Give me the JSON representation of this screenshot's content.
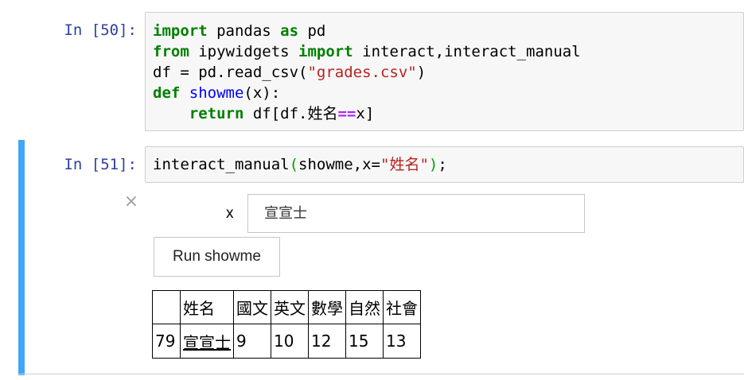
{
  "cell50": {
    "prompt": "In [50]:",
    "lines": [
      {
        "parts": [
          [
            "kw",
            "import"
          ],
          [
            "txt",
            " pandas "
          ],
          [
            "kw",
            "as"
          ],
          [
            "txt",
            " pd"
          ]
        ]
      },
      {
        "parts": [
          [
            "kw",
            "from"
          ],
          [
            "txt",
            " ipywidgets "
          ],
          [
            "kw",
            "import"
          ],
          [
            "txt",
            " interact,interact_manual"
          ]
        ]
      },
      {
        "parts": [
          [
            "txt",
            "df = pd.read_csv("
          ],
          [
            "str",
            "\"grades.csv\""
          ],
          [
            "txt",
            ")"
          ]
        ]
      },
      {
        "parts": [
          [
            "kw",
            "def"
          ],
          [
            "txt",
            " "
          ],
          [
            "fn",
            "showme"
          ],
          [
            "txt",
            "(x):"
          ]
        ]
      },
      {
        "parts": [
          [
            "txt",
            "    "
          ],
          [
            "kw",
            "return"
          ],
          [
            "txt",
            " df[df.姓名"
          ],
          [
            "op",
            "=="
          ],
          [
            "txt",
            "x]"
          ]
        ]
      }
    ]
  },
  "cell51": {
    "prompt": "In [51]:",
    "line": [
      [
        "txt",
        "interact_manual"
      ],
      [
        "paren",
        "("
      ],
      [
        "txt",
        "showme,x="
      ],
      [
        "str",
        "\"姓名\""
      ],
      [
        "paren",
        ")"
      ],
      [
        "txt",
        ";"
      ]
    ],
    "close_symbol": "×",
    "widget": {
      "label": "x",
      "value": "宣宣士",
      "button_label": "Run showme"
    },
    "table": {
      "headers": [
        "",
        "姓名",
        "國文",
        "英文",
        "數學",
        "自然",
        "社會"
      ],
      "rows": [
        {
          "index": "79",
          "values": [
            "宣宣士",
            "9",
            "10",
            "12",
            "15",
            "13"
          ]
        }
      ]
    }
  }
}
